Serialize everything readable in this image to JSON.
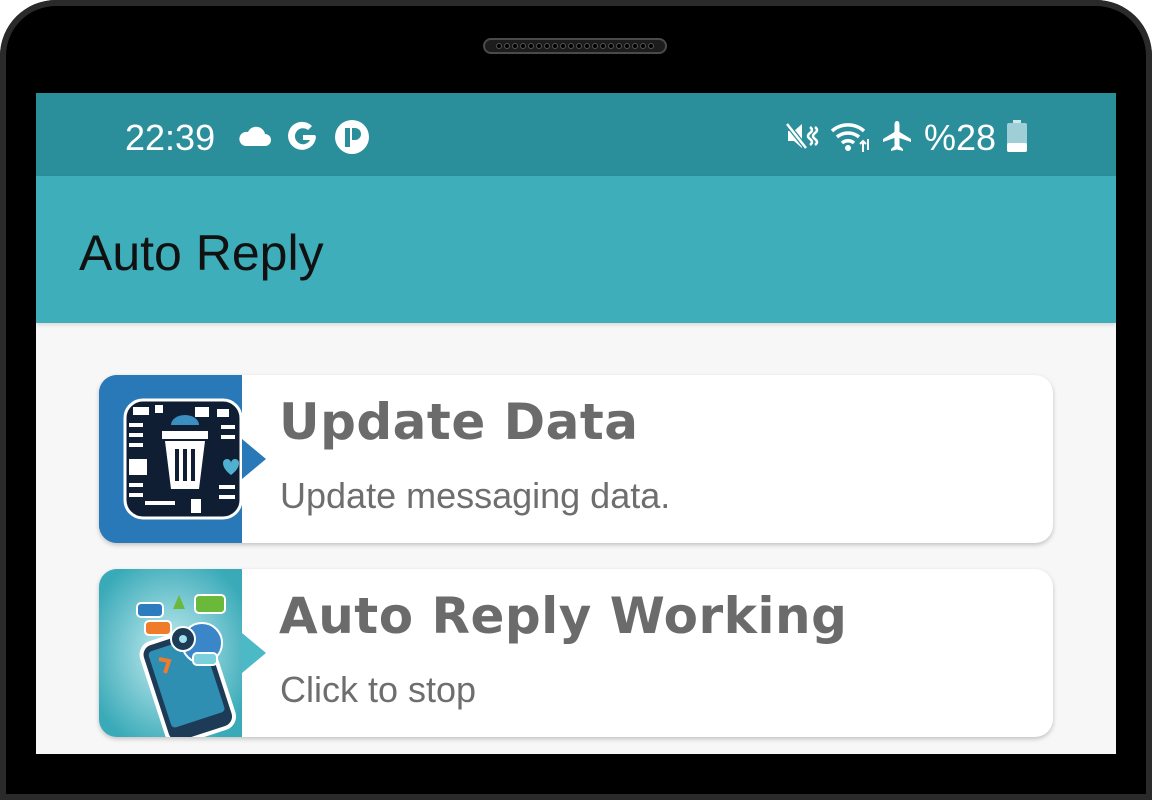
{
  "status_bar": {
    "time": "22:39",
    "left_icons": [
      "cloud-icon",
      "google-icon",
      "p-app-icon"
    ],
    "right_icons": [
      "mute-vibrate-icon",
      "wifi-icon",
      "airplane-icon"
    ],
    "battery_text": "%28"
  },
  "app_bar": {
    "title": "Auto Reply",
    "color": "#3eaeba",
    "status_color": "#2b8f9b"
  },
  "cards": [
    {
      "title": "Update Data",
      "subtitle": "Update messaging data.",
      "icon": "trash-data-icon",
      "accent": "#2978b8"
    },
    {
      "title": "Auto Reply Working",
      "subtitle": "Click to stop",
      "icon": "phone-chat-icon",
      "accent": "#4bb9c6"
    }
  ]
}
